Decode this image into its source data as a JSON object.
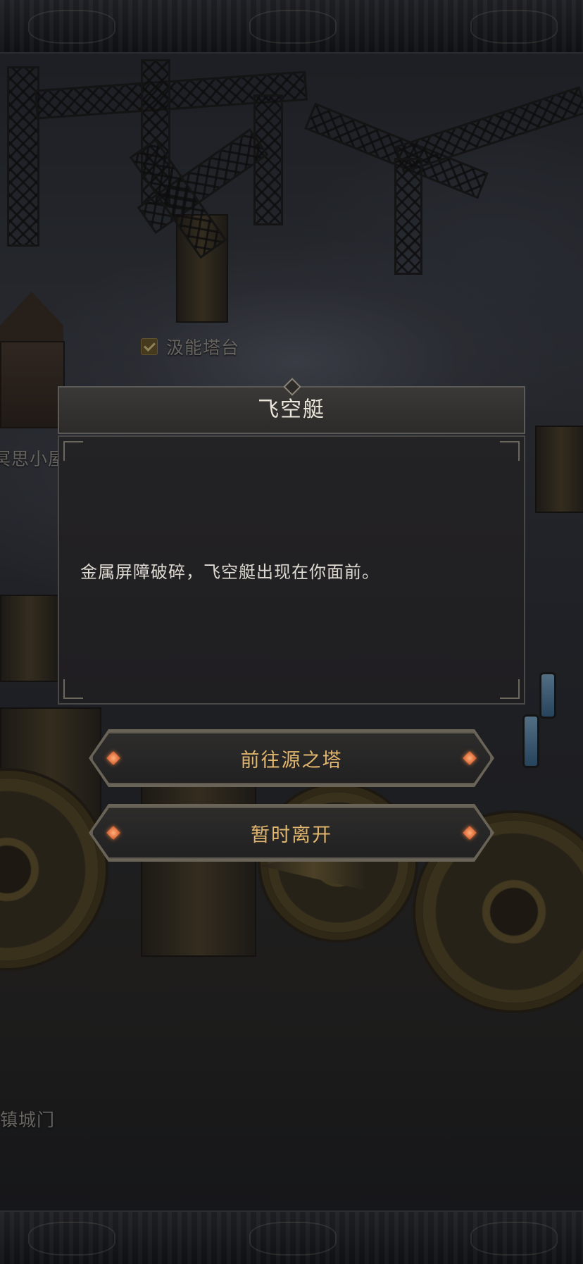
{
  "scene": {
    "labels": {
      "tower": "汲能塔台",
      "cabin": "冥思小屋",
      "gate": "镇城门"
    }
  },
  "dialog": {
    "title": "飞空艇",
    "message": "金属屏障破碎，飞空艇出现在你面前。"
  },
  "choices": [
    {
      "label": "前往源之塔"
    },
    {
      "label": "暂时离开"
    }
  ],
  "colors": {
    "choice_text": "#e1b66e",
    "title_text": "#ece7dc",
    "gem": "#d4582a"
  }
}
